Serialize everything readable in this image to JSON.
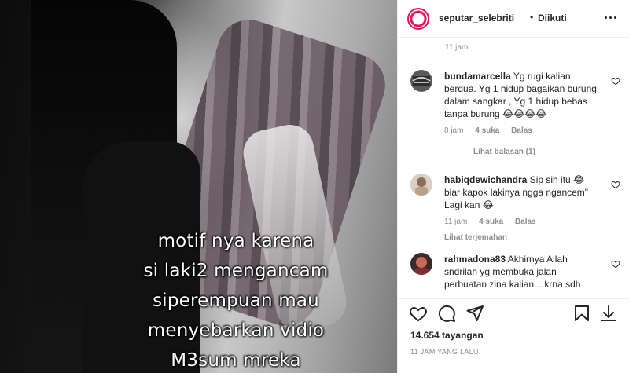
{
  "video": {
    "caption_lines": [
      "motif nya karena",
      "si laki2 mengancam",
      "siperempuan mau",
      "menyebarkan vidio",
      "M3sum mreka"
    ]
  },
  "header": {
    "username": "seputar_selebriti",
    "separator": "•",
    "follow_status": "Diikuti",
    "more_icon": "more-horizontal-icon"
  },
  "comments": {
    "top_timestamp": "11 jam",
    "items": [
      {
        "user": "bundamarcella",
        "text": "Yg rugi kalian berdua. Yg 1 hidup bagaikan burung dalam sangkar , Yg 1 hidup bebas tanpa burung 😂😂😂😂",
        "time": "8 jam",
        "likes": "4 suka",
        "reply": "Balas",
        "view_replies": "Lihat balasan (1)"
      },
      {
        "user": "habiqdewichandra",
        "text": "Sip sih itu 😂 biar kapok lakinya ngga ngancem\" Lagi kan 😂",
        "time": "11 jam",
        "likes": "4 suka",
        "reply": "Balas",
        "translate": "Lihat terjemahan"
      },
      {
        "user": "rahmadona83",
        "text": "Akhirnya Allah sndrilah yg membuka jalan perbuatan zina kalian....krna sdh"
      }
    ]
  },
  "actions": {
    "icons": [
      "heart-icon",
      "comment-icon",
      "share-icon",
      "save-icon",
      "download-icon"
    ]
  },
  "stats": {
    "views": "14.654 tayangan",
    "time_ago": "11 JAM YANG LALU"
  },
  "colors": {
    "brand": "#e4155b",
    "text": "#262626",
    "muted": "#8e8e8e",
    "border": "#efefef"
  }
}
